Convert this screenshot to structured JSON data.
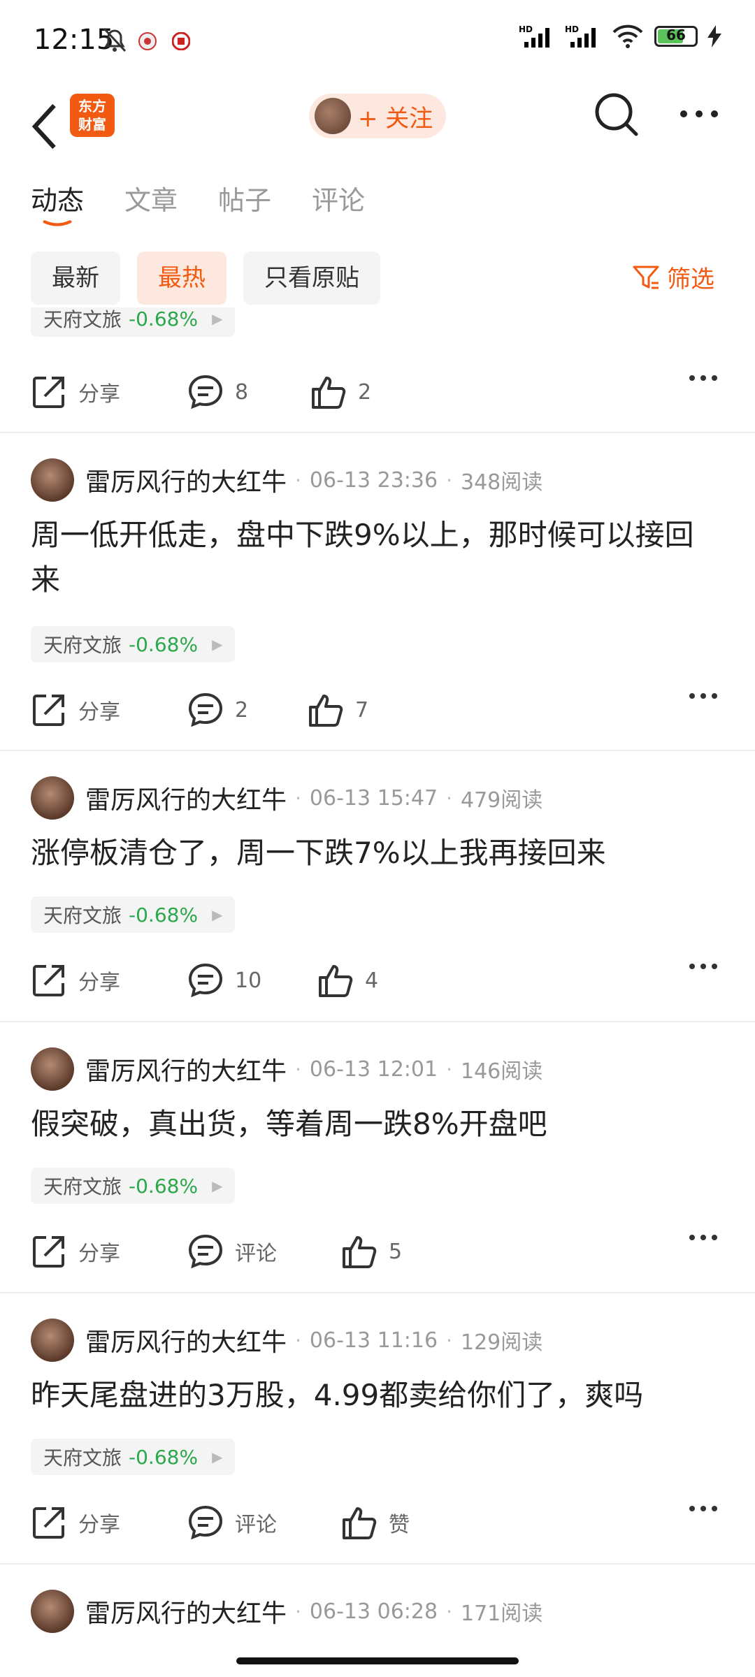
{
  "status_bar": {
    "time": "12:15",
    "battery": "66",
    "icons": [
      "bell-off-icon",
      "app-icon-1",
      "app-icon-2",
      "hd-signal-icon",
      "hd-signal-icon",
      "wifi-icon",
      "battery-icon",
      "charging-icon"
    ]
  },
  "header": {
    "logo_line1": "东方",
    "logo_line2": "财富",
    "follow_label": "+ 关注"
  },
  "tabs": [
    {
      "label": "动态",
      "active": true
    },
    {
      "label": "文章",
      "active": false
    },
    {
      "label": "帖子",
      "active": false
    },
    {
      "label": "评论",
      "active": false
    }
  ],
  "filters": {
    "chips": [
      {
        "label": "最新",
        "active": false
      },
      {
        "label": "最热",
        "active": true
      },
      {
        "label": "只看原贴",
        "active": false
      }
    ],
    "filter_label": "筛选"
  },
  "top_partial": {
    "stock_name": "天府文旅",
    "stock_change": "-0.68%",
    "share": "分享",
    "comments": "8",
    "likes": "2"
  },
  "posts": [
    {
      "author": "雷厉风行的大红牛",
      "time": "06-13 23:36",
      "reads": "348阅读",
      "content": "周一低开低走，盘中下跌9%以上，那时候可以接回来",
      "stock_name": "天府文旅",
      "stock_change": "-0.68%",
      "share": "分享",
      "comments": "2",
      "likes": "7"
    },
    {
      "author": "雷厉风行的大红牛",
      "time": "06-13 15:47",
      "reads": "479阅读",
      "content": "涨停板清仓了，周一下跌7%以上我再接回来",
      "stock_name": "天府文旅",
      "stock_change": "-0.68%",
      "share": "分享",
      "comments": "10",
      "likes": "4"
    },
    {
      "author": "雷厉风行的大红牛",
      "time": "06-13 12:01",
      "reads": "146阅读",
      "content": "假突破，真出货，等着周一跌8%开盘吧",
      "stock_name": "天府文旅",
      "stock_change": "-0.68%",
      "share": "分享",
      "comments": "评论",
      "likes": "5"
    },
    {
      "author": "雷厉风行的大红牛",
      "time": "06-13 11:16",
      "reads": "129阅读",
      "content": "昨天尾盘进的3万股，4.99都卖给你们了，爽吗",
      "stock_name": "天府文旅",
      "stock_change": "-0.68%",
      "share": "分享",
      "comments": "评论",
      "likes": "赞"
    },
    {
      "author": "雷厉风行的大红牛",
      "time": "06-13 06:28",
      "reads": "171阅读"
    }
  ],
  "colors": {
    "accent": "#f25a12",
    "positive_green": "#2aa84a"
  }
}
